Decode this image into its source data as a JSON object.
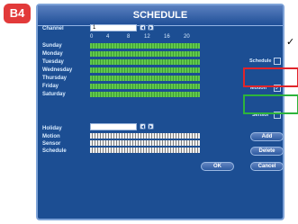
{
  "badge": "B4",
  "checkmark": "✓",
  "window": {
    "title": "SCHEDULE"
  },
  "channel": {
    "label": "Channel",
    "value": "1"
  },
  "timeline": {
    "ticks": [
      "0",
      "4",
      "8",
      "12",
      "16",
      "20"
    ]
  },
  "days": [
    "Sunday",
    "Monday",
    "Tuesday",
    "Wednesday",
    "Thursday",
    "Friday",
    "Saturday"
  ],
  "holiday": {
    "label": "Holiday"
  },
  "legend_rows": [
    "Motion",
    "Sensor",
    "Schedule"
  ],
  "options": {
    "schedule_label": "Schedule",
    "motion_label": "Motion",
    "sensor_label": "Sensor",
    "schedule_checked": false,
    "motion_checked": true,
    "sensor_checked": false
  },
  "buttons": {
    "add": "Add",
    "delete": "Delete",
    "ok": "OK",
    "cancel": "Cancel"
  },
  "colors": {
    "window_bg": "#1c4e93",
    "bar_green": "#61c84c",
    "highlight_red": "#e0242a",
    "highlight_green": "#2db43b"
  }
}
